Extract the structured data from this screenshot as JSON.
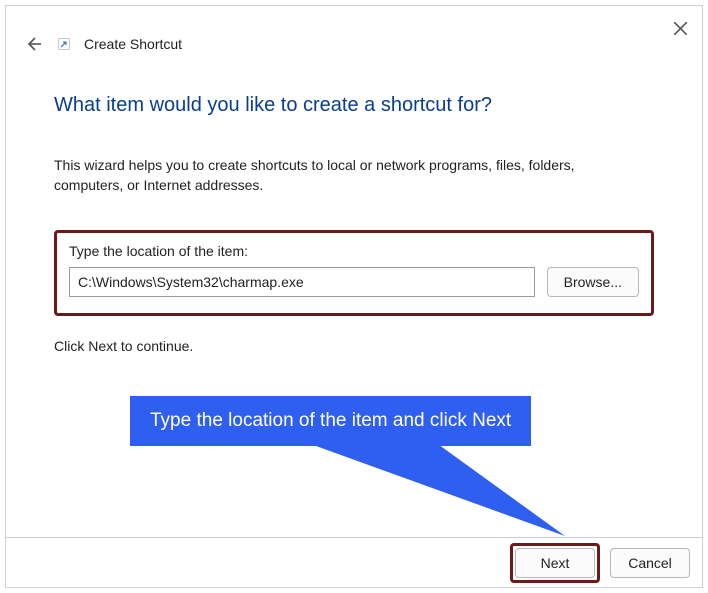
{
  "window": {
    "title": "Create Shortcut"
  },
  "heading": "What item would you like to create a shortcut for?",
  "description": "This wizard helps you to create shortcuts to local or network programs, files, folders, computers, or Internet addresses.",
  "location": {
    "label": "Type the location of the item:",
    "value": "C:\\Windows\\System32\\charmap.exe",
    "browse": "Browse..."
  },
  "continue_hint": "Click Next to continue.",
  "annotation": "Type the location of the item and click Next",
  "footer": {
    "next": "Next",
    "cancel": "Cancel"
  }
}
